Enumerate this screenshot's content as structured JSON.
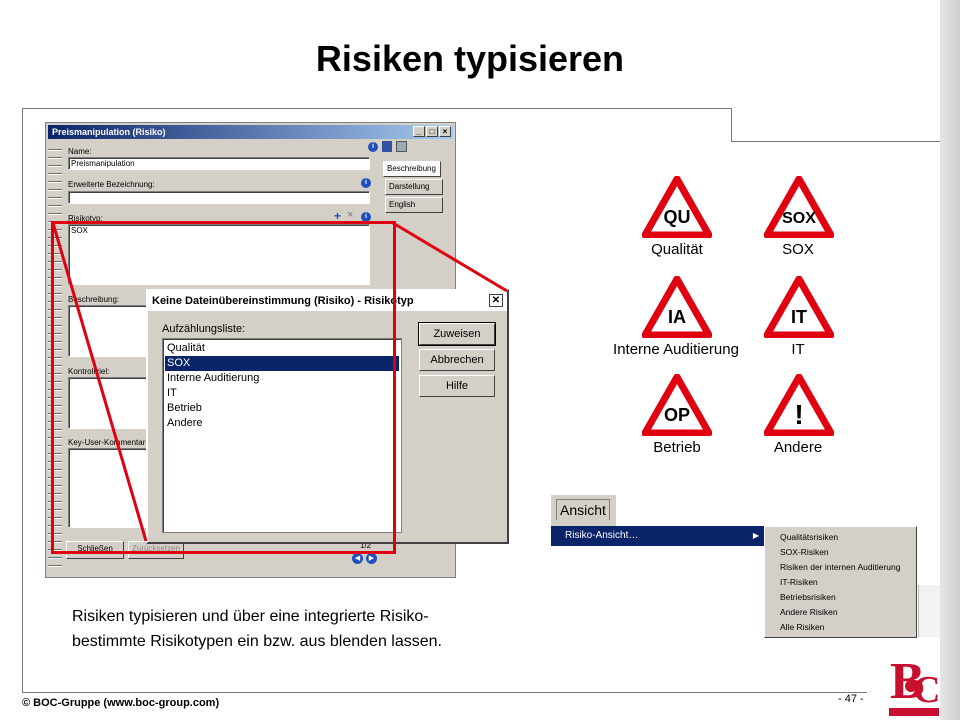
{
  "slide": {
    "title": "Risiken typisieren",
    "caption_line1": "Risiken typisieren und über eine integrierte Risiko-",
    "caption_line2": "bestimmte Risikotypen ein bzw. aus blenden lassen.",
    "footer_left": "© BOC-Gruppe (www.boc-group.com)",
    "page_number": "- 47 -"
  },
  "form_window": {
    "title": "Preismanipulation (Risiko)",
    "name_label": "Name:",
    "name_value": "Preismanipulation",
    "ext_label": "Erweiterte Bezeichnung:",
    "risikotyp_label": "Risikotyp:",
    "risikotyp_value": "SOX",
    "beschreibung_label": "Beschreibung:",
    "kontrollziel_label": "Kontrollziel:",
    "keyuser_label": "Key-User-Kommentare:",
    "close_button": "Schließen",
    "reset_button": "Zurücksetzen",
    "page_indicator": "1/2",
    "tabs": [
      "Beschreibung",
      "Darstellung",
      "English"
    ]
  },
  "dialog": {
    "title": "Keine Dateinübereinstimmung (Risiko) - Risikotyp",
    "list_label": "Aufzählungsliste:",
    "items": [
      "Qualität",
      "SOX",
      "Interne Auditierung",
      "IT",
      "Betrieb",
      "Andere"
    ],
    "selected_index": 1,
    "buttons": [
      "Zuweisen",
      "Abbrechen",
      "Hilfe"
    ]
  },
  "signs": [
    {
      "symbol": "QU",
      "label": "Qualität"
    },
    {
      "symbol": "SOX",
      "label": "SOX"
    },
    {
      "symbol": "IA",
      "label": "Interne Auditierung"
    },
    {
      "symbol": "IT",
      "label": "IT"
    },
    {
      "symbol": "OP",
      "label": "Betrieb"
    },
    {
      "symbol": "!",
      "label": "Andere"
    }
  ],
  "menu": {
    "menubar_item": "Ansicht",
    "highlighted_item": "Risiko-Ansicht…",
    "submenu": [
      "Qualitätsrisiken",
      "SOX-Risiken",
      "Risiken der internen Auditierung",
      "IT-Risiken",
      "Betriebsrisiken",
      "Andere Risiken",
      "Alle Risiken"
    ]
  },
  "colors": {
    "sign_red": "#e00010",
    "title_bar_blue": "#0a246a",
    "highlight_red": "#e00010"
  }
}
